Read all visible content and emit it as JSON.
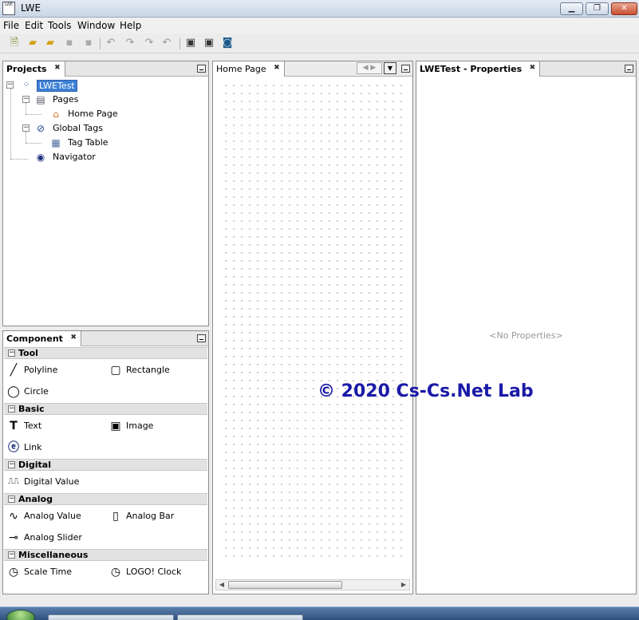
{
  "window": {
    "title": "LWE",
    "app_icon_text": "LWE"
  },
  "menu": [
    "File",
    "Edit",
    "Tools",
    "Window",
    "Help"
  ],
  "toolbar": {
    "icons": [
      "new-project-icon",
      "add-page-icon",
      "open-folder-icon",
      "save-icon",
      "save-all-icon",
      "undo-icon",
      "redo-icon",
      "redo-alt-icon",
      "undo-alt-icon",
      "build-icon",
      "deploy-icon",
      "simulate-icon"
    ]
  },
  "projects": {
    "title": "Projects",
    "tree": {
      "root": "LWETest",
      "pages": "Pages",
      "home_page": "Home Page",
      "global_tags": "Global Tags",
      "tag_table": "Tag Table",
      "navigator": "Navigator"
    }
  },
  "component": {
    "title": "Component",
    "sections": {
      "tool": {
        "label": "Tool",
        "items": [
          "Polyline",
          "Rectangle",
          "Circle"
        ]
      },
      "basic": {
        "label": "Basic",
        "items": [
          "Text",
          "Image",
          "Link"
        ]
      },
      "digital": {
        "label": "Digital",
        "items": [
          "Digital Value"
        ]
      },
      "analog": {
        "label": "Analog",
        "items": [
          "Analog Value",
          "Analog Bar",
          "Analog Slider"
        ]
      },
      "misc": {
        "label": "Miscellaneous",
        "items": [
          "Scale Time",
          "LOGO! Clock"
        ]
      }
    }
  },
  "editor": {
    "tab": "Home Page"
  },
  "properties": {
    "title": "LWETest - Properties",
    "empty_text": "<No Properties>"
  },
  "watermark": "© 2020 Cs-Cs.Net Lab"
}
